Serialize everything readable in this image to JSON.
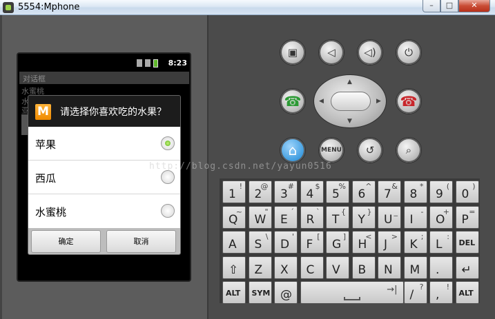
{
  "window": {
    "title": "5554:Mphone",
    "min": "–",
    "max": "□",
    "close": "✕"
  },
  "screen": {
    "clock": "8:23",
    "app_title": "对话框",
    "bg_line1": "水蜜桃",
    "bg_line2": "水",
    "bg_line3": "亚"
  },
  "dialog": {
    "logo_letter": "M",
    "title": "请选择你喜欢吃的水果？",
    "items": [
      {
        "label": "苹果",
        "checked": true
      },
      {
        "label": "西瓜",
        "checked": false
      },
      {
        "label": "水蜜桃",
        "checked": false
      }
    ],
    "ok": "确定",
    "cancel": "取消"
  },
  "hardware": {
    "menu": "MENU",
    "icons": [
      "camera-icon",
      "volume-down-icon",
      "volume-up-icon",
      "power-icon",
      "call-icon",
      "end-call-icon",
      "home-icon",
      "back-icon",
      "search-icon"
    ],
    "glyphs": {
      "camera": "▣",
      "vol_down": "◁",
      "vol_up": "◁)",
      "power": "⏻",
      "call": "☎",
      "end": "☎",
      "home": "⌂",
      "back": "↺",
      "search": "⌕",
      "up": "▲",
      "down": "▼",
      "left": "◀",
      "right": "▶"
    }
  },
  "keyboard": {
    "row1": [
      {
        "k": "1",
        "a": "!"
      },
      {
        "k": "2",
        "a": "@"
      },
      {
        "k": "3",
        "a": "#"
      },
      {
        "k": "4",
        "a": "$"
      },
      {
        "k": "5",
        "a": "%"
      },
      {
        "k": "6",
        "a": "^"
      },
      {
        "k": "7",
        "a": "&"
      },
      {
        "k": "8",
        "a": "*"
      },
      {
        "k": "9",
        "a": "("
      },
      {
        "k": "0",
        "a": ")"
      }
    ],
    "row2": [
      {
        "k": "Q",
        "a": "~"
      },
      {
        "k": "W",
        "a": "\""
      },
      {
        "k": "E",
        "a": "´"
      },
      {
        "k": "R",
        "a": "`"
      },
      {
        "k": "T",
        "a": "{"
      },
      {
        "k": "Y",
        "a": "}"
      },
      {
        "k": "U",
        "a": "_"
      },
      {
        "k": "I",
        "a": "-"
      },
      {
        "k": "O",
        "a": "+"
      },
      {
        "k": "P",
        "a": "="
      }
    ],
    "row3": [
      {
        "k": "A",
        "a": ""
      },
      {
        "k": "S",
        "a": "\\"
      },
      {
        "k": "D",
        "a": "'"
      },
      {
        "k": "F",
        "a": "["
      },
      {
        "k": "G",
        "a": "]"
      },
      {
        "k": "H",
        "a": "<"
      },
      {
        "k": "J",
        "a": ">"
      },
      {
        "k": "K",
        "a": ";"
      },
      {
        "k": "L",
        "a": ":"
      },
      {
        "k": "DEL",
        "a": ""
      }
    ],
    "row4": [
      {
        "k": "⇧",
        "a": ""
      },
      {
        "k": "Z",
        "a": ""
      },
      {
        "k": "X",
        "a": ""
      },
      {
        "k": "C",
        "a": ""
      },
      {
        "k": "V",
        "a": ""
      },
      {
        "k": "B",
        "a": ""
      },
      {
        "k": "N",
        "a": ""
      },
      {
        "k": "M",
        "a": ""
      },
      {
        "k": ".",
        "a": ""
      },
      {
        "k": "↵",
        "a": ""
      }
    ],
    "row5": {
      "alt_left": "ALT",
      "sym": "SYM",
      "at": "@",
      "space_arrow": "→|",
      "slash": "/",
      "slash_alt": "?",
      "comma": ",",
      "comma_alt": "!",
      "alt_right": "ALT"
    }
  },
  "watermark": "http://blog.csdn.net/yayun0516"
}
